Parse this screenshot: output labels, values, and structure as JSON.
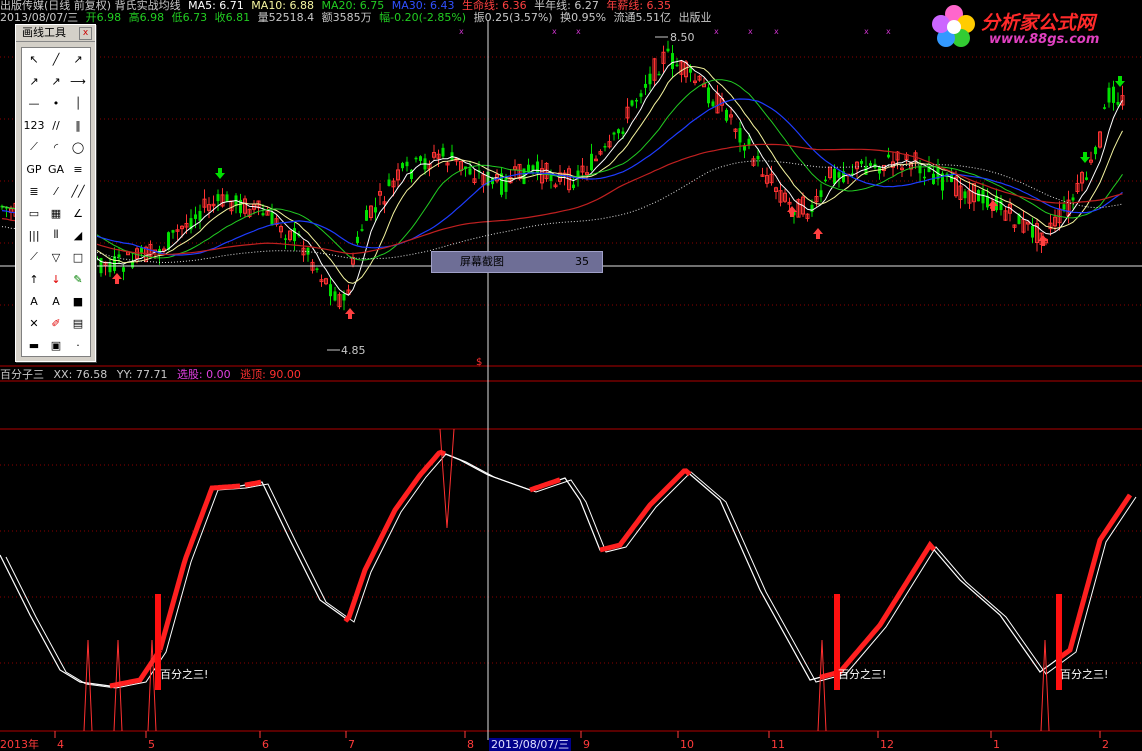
{
  "header_line1": {
    "title": "出版传媒(日线 前复权) 背氏实战均线",
    "ma5": "MA5: 6.71",
    "ma10": "MA10: 6.88",
    "ma20": "MA20: 6.75",
    "ma30": "MA30: 6.43",
    "lifeline": "生命线: 6.36",
    "halfyear": "半年线: 6.27",
    "yearline": "年薪线: 6.35"
  },
  "header_line2": {
    "date": "2013/08/07/三",
    "open": "开6.98",
    "high": "高6.98",
    "low": "低6.73",
    "close": "收6.81",
    "volume": "量52518.4",
    "amount": "额3585万",
    "change": "幅-0.20(-2.85%)",
    "amplitude": "振0.25(3.57%)",
    "turnover": "换0.95%",
    "float": "流通5.51亿",
    "industry": "出版业"
  },
  "logo": {
    "title": "分析家公式网",
    "url": "www.88gs.com"
  },
  "toolbox": {
    "title": "画线工具",
    "close": "x"
  },
  "popup": {
    "label": "屏幕截图",
    "value": "35"
  },
  "price_labels": {
    "high": "8.50",
    "low": "4.85"
  },
  "indicator_header": {
    "name": "百分子三",
    "xx": "XX: 76.58",
    "yy": "YY: 77.71",
    "select": "选股: 0.00",
    "escape": "逃顶: 90.00"
  },
  "signal_label": "百分之三!",
  "x_axis": {
    "labels": [
      "2013年",
      "4",
      "5",
      "6",
      "7",
      "8",
      "9",
      "10",
      "11",
      "12",
      "1",
      "2"
    ],
    "current_date": "2013/08/07/三"
  },
  "colors": {
    "up": "#ff3232",
    "down": "#00e000",
    "ma5": "#ffffff",
    "ma10": "#f5f5a0",
    "ma20": "#22cc22",
    "ma30": "#1e3cff",
    "lifeline": "#c02020",
    "grid": "#8b0000"
  },
  "toolbox_icons": [
    "cursor-icon",
    "line-icon",
    "ray-icon",
    "arrow-line-icon",
    "segment-icon",
    "extend-line-icon",
    "hline-icon",
    "dot-line-icon",
    "vline-icon",
    "text-123-icon",
    "parallel-icon",
    "channel-icon",
    "fib-line-icon",
    "arc-icon",
    "circle-icon",
    "cycle-icon",
    "gp-icon",
    "ga-icon",
    "gann-icon",
    "fan-icon",
    "speed-icon",
    "box-icon",
    "grid-icon",
    "angle-icon",
    "bars-icon",
    "time-icon",
    "period-icon",
    "fan2-icon",
    "gannfan-icon",
    "triangle-icon",
    "rect-icon",
    "up-arrow-icon",
    "down-arrow-icon",
    "pen-icon",
    "text-a-icon",
    "text-a2-icon",
    "block-icon",
    "delete-icon",
    "draw-icon",
    "notes-icon",
    "ruler-icon",
    "save-icon"
  ]
}
